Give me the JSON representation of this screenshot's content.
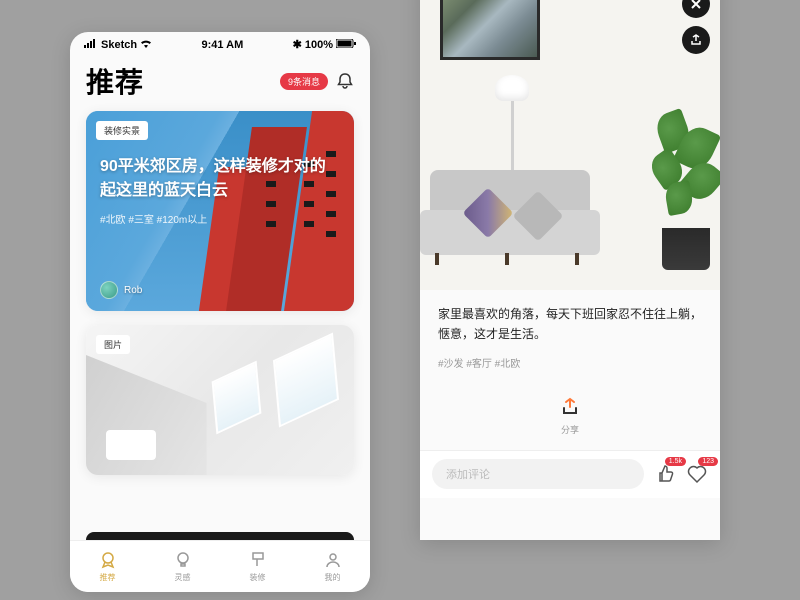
{
  "status": {
    "carrier": "Sketch",
    "time": "9:41 AM",
    "battery": "100%"
  },
  "header": {
    "title": "推荐",
    "badge": "9条消息"
  },
  "cards": [
    {
      "chip": "装修实景",
      "title": "90平米郊区房，这样装修才对的起这里的蓝天白云",
      "tags": "#北欧 #三室 #120m以上",
      "author": "Rob"
    },
    {
      "chip": "图片"
    }
  ],
  "tabs": [
    {
      "label": "推荐"
    },
    {
      "label": "灵感"
    },
    {
      "label": "装修"
    },
    {
      "label": "我的"
    }
  ],
  "detail": {
    "text": "家里最喜欢的角落，每天下班回家忍不住往上躺，惬意，这才是生活。",
    "tags": "#沙发  #客厅  #北欧",
    "share": "分享",
    "comment_placeholder": "添加评论",
    "like_count": "1.5k",
    "fav_count": "123"
  }
}
